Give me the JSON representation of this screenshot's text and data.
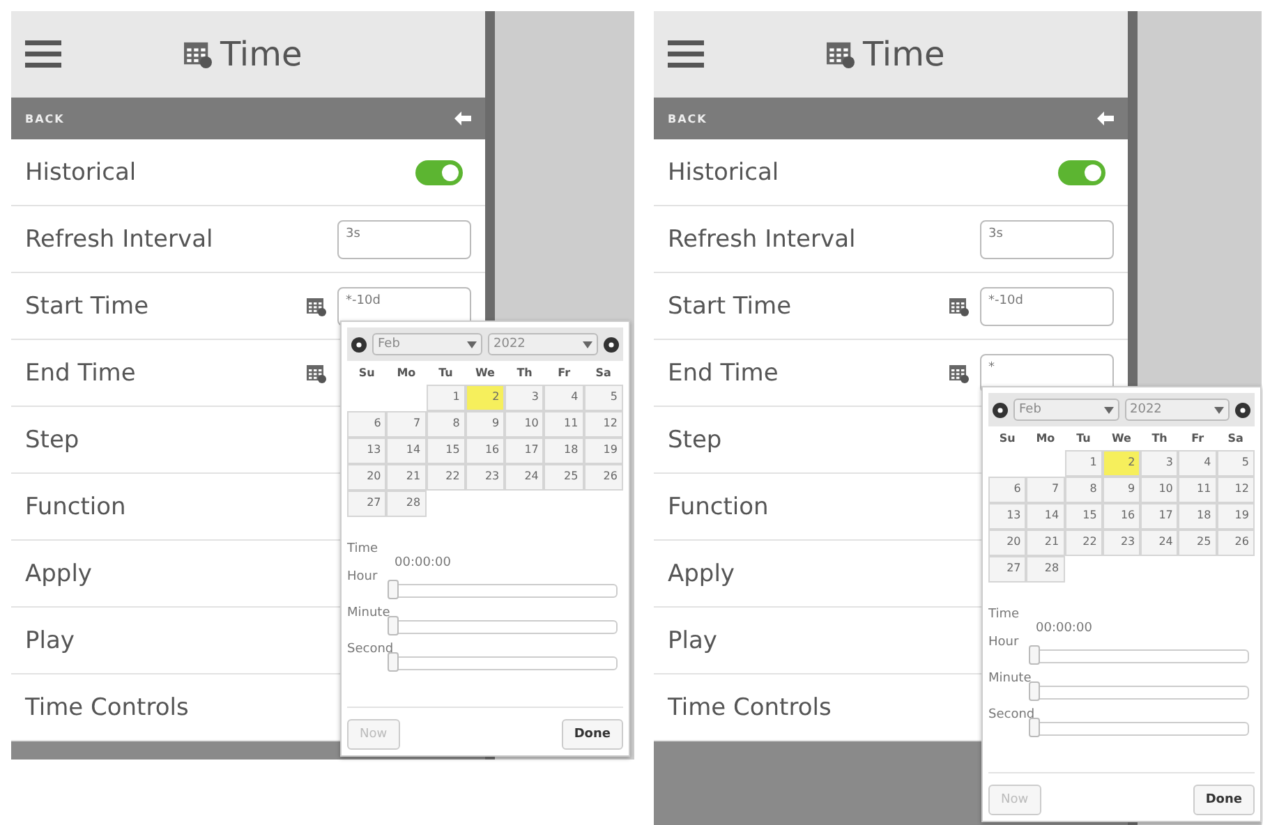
{
  "screens": [
    {
      "title": "Time",
      "back_label": "BACK",
      "rows": [
        {
          "kind": "toggle",
          "label": "Historical",
          "on": true
        },
        {
          "kind": "input",
          "label": "Refresh Interval",
          "value": "3s"
        },
        {
          "kind": "datetime",
          "label": "Start Time",
          "value": "*-10d"
        },
        {
          "kind": "datetime",
          "label": "End Time"
        },
        {
          "kind": "plain",
          "label": "Step"
        },
        {
          "kind": "plain",
          "label": "Function"
        },
        {
          "kind": "plain",
          "label": "Apply"
        },
        {
          "kind": "plain",
          "label": "Play"
        },
        {
          "kind": "plain",
          "label": "Time Controls"
        }
      ],
      "datepicker": {
        "month": "Feb",
        "year": "2022",
        "weekdays": [
          "Su",
          "Mo",
          "Tu",
          "We",
          "Th",
          "Fr",
          "Sa"
        ],
        "weeks": [
          [
            {
              "day": "1",
              "selected": false
            },
            {
              "day": "2",
              "selected": true
            },
            {
              "day": "3",
              "selected": false
            },
            {
              "day": "4",
              "selected": false
            },
            {
              "day": "5",
              "selected": false
            }
          ],
          [
            {
              "day": "6",
              "selected": false
            },
            {
              "day": "7",
              "selected": false
            },
            {
              "day": "8",
              "selected": false
            },
            {
              "day": "9",
              "selected": false
            },
            {
              "day": "10",
              "selected": false
            },
            {
              "day": "11",
              "selected": false
            },
            {
              "day": "12",
              "selected": false
            }
          ],
          [
            {
              "day": "13",
              "selected": false
            },
            {
              "day": "14",
              "selected": false
            },
            {
              "day": "15",
              "selected": false
            },
            {
              "day": "16",
              "selected": false
            },
            {
              "day": "17",
              "selected": false
            },
            {
              "day": "18",
              "selected": false
            },
            {
              "day": "19",
              "selected": false
            }
          ],
          [
            {
              "day": "20",
              "selected": false
            },
            {
              "day": "21",
              "selected": false
            },
            {
              "day": "22",
              "selected": false
            },
            {
              "day": "23",
              "selected": false
            },
            {
              "day": "24",
              "selected": false
            },
            {
              "day": "25",
              "selected": false
            },
            {
              "day": "26",
              "selected": false
            }
          ],
          [
            {
              "day": "27",
              "selected": false
            },
            {
              "day": "28",
              "selected": false
            }
          ]
        ],
        "time_label": "Time",
        "time_value": "00:00:00",
        "sliders": [
          {
            "label": "Hour",
            "level": 0
          },
          {
            "label": "Minute",
            "level": 0
          },
          {
            "label": "Second",
            "level": 0
          }
        ],
        "buttons": [
          {
            "label": "Now",
            "disabled": true
          },
          {
            "label": "Done",
            "disabled": false
          }
        ]
      }
    },
    {
      "title": "Time",
      "back_label": "BACK",
      "rows": [
        {
          "kind": "toggle",
          "label": "Historical",
          "on": true
        },
        {
          "kind": "input",
          "label": "Refresh Interval",
          "value": "3s"
        },
        {
          "kind": "datetime",
          "label": "Start Time",
          "value": "*-10d"
        },
        {
          "kind": "datetime",
          "label": "End Time",
          "value": "*"
        },
        {
          "kind": "plain",
          "label": "Step"
        },
        {
          "kind": "plain",
          "label": "Function"
        },
        {
          "kind": "plain",
          "label": "Apply"
        },
        {
          "kind": "plain",
          "label": "Play"
        },
        {
          "kind": "plain",
          "label": "Time Controls"
        }
      ],
      "datepicker": {
        "month": "Feb",
        "year": "2022",
        "weekdays": [
          "Su",
          "Mo",
          "Tu",
          "We",
          "Th",
          "Fr",
          "Sa"
        ],
        "weeks": [
          [
            {
              "day": "1",
              "selected": false
            },
            {
              "day": "2",
              "selected": true
            },
            {
              "day": "3",
              "selected": false
            },
            {
              "day": "4",
              "selected": false
            },
            {
              "day": "5",
              "selected": false
            }
          ],
          [
            {
              "day": "6",
              "selected": false
            },
            {
              "day": "7",
              "selected": false
            },
            {
              "day": "8",
              "selected": false
            },
            {
              "day": "9",
              "selected": false
            },
            {
              "day": "10",
              "selected": false
            },
            {
              "day": "11",
              "selected": false
            },
            {
              "day": "12",
              "selected": false
            }
          ],
          [
            {
              "day": "13",
              "selected": false
            },
            {
              "day": "14",
              "selected": false
            },
            {
              "day": "15",
              "selected": false
            },
            {
              "day": "16",
              "selected": false
            },
            {
              "day": "17",
              "selected": false
            },
            {
              "day": "18",
              "selected": false
            },
            {
              "day": "19",
              "selected": false
            }
          ],
          [
            {
              "day": "20",
              "selected": false
            },
            {
              "day": "21",
              "selected": false
            },
            {
              "day": "22",
              "selected": false
            },
            {
              "day": "23",
              "selected": false
            },
            {
              "day": "24",
              "selected": false
            },
            {
              "day": "25",
              "selected": false
            },
            {
              "day": "26",
              "selected": false
            }
          ],
          [
            {
              "day": "27",
              "selected": false
            },
            {
              "day": "28",
              "selected": false
            }
          ]
        ],
        "time_label": "Time",
        "time_value": "00:00:00",
        "sliders": [
          {
            "label": "Hour",
            "level": 0
          },
          {
            "label": "Minute",
            "level": 0
          },
          {
            "label": "Second",
            "level": 0
          }
        ],
        "buttons": [
          {
            "label": "Now",
            "disabled": true
          },
          {
            "label": "Done",
            "disabled": false
          }
        ]
      }
    }
  ]
}
